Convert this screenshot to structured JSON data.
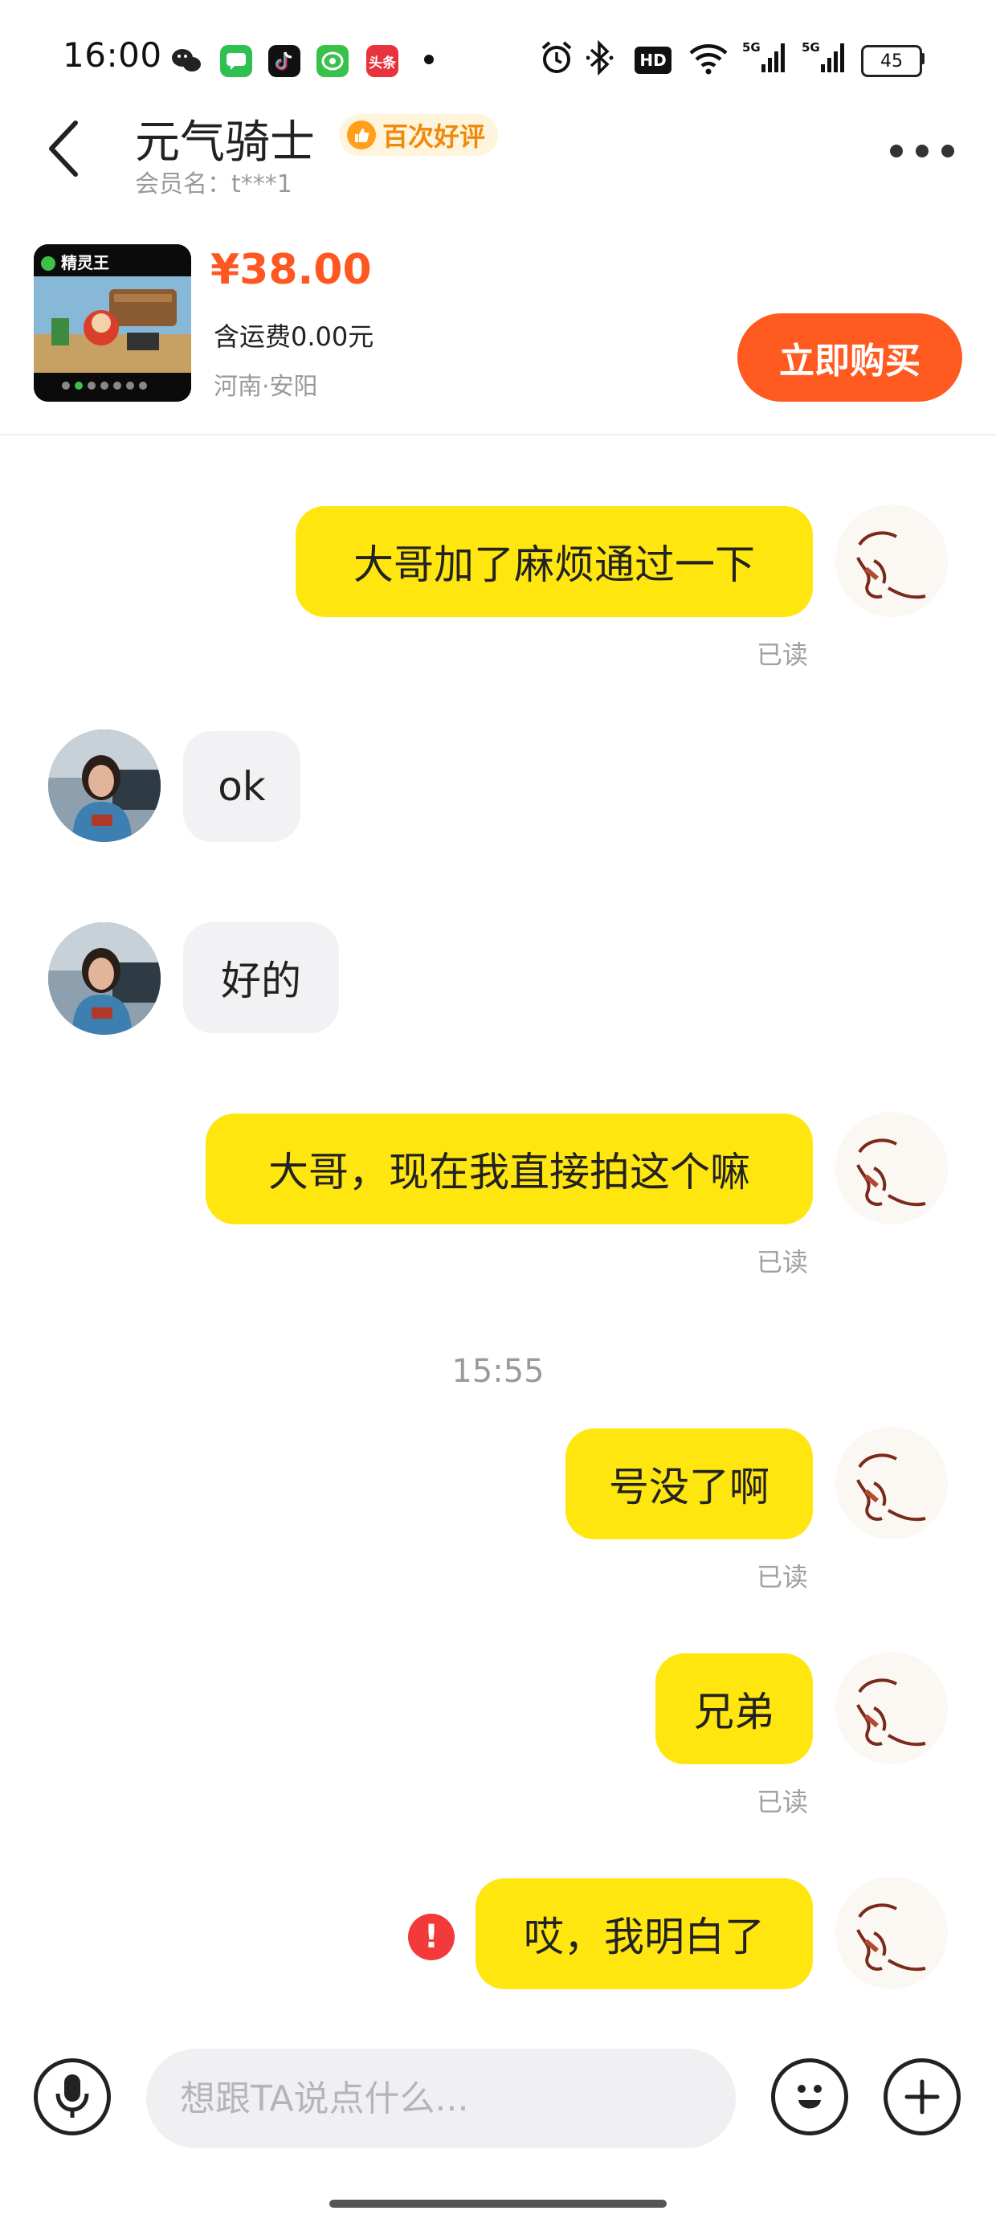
{
  "status_bar": {
    "time": "16:00",
    "apps": [
      {
        "icon": "wechat-icon",
        "color": "#222222"
      },
      {
        "icon": "messages-icon",
        "color": "#2ec050"
      },
      {
        "icon": "tiktok-icon",
        "color": "#111111"
      },
      {
        "icon": "facetime-icon",
        "color": "#39c24a"
      },
      {
        "icon": "toutiao-icon",
        "color": "#e8323c",
        "label": "头条"
      }
    ],
    "system_icons": [
      "alarm-icon",
      "bluetooth-icon",
      "hd-icon",
      "wifi-icon",
      "signal-5g-icon",
      "signal-5g-icon"
    ],
    "hd_label": "HD",
    "net_label": "5G",
    "battery": "45"
  },
  "header": {
    "title": "元气骑士",
    "badge": "百次好评",
    "member": "会员名：t***1"
  },
  "product": {
    "price": "¥38.00",
    "shipping": "含运费0.00元",
    "location": "河南·安阳",
    "buy_label": "立即购买",
    "thumb_label": "精灵王"
  },
  "messages": [
    {
      "from": "me",
      "text": "大哥加了麻烦通过一下",
      "status": "已读"
    },
    {
      "from": "other",
      "text": "ok"
    },
    {
      "from": "other",
      "text": "好的"
    },
    {
      "from": "me",
      "text": "大哥，现在我直接拍这个嘛",
      "status": "已读"
    },
    {
      "type": "time",
      "text": "15:55"
    },
    {
      "from": "me",
      "text": "号没了啊",
      "status": "已读"
    },
    {
      "from": "me",
      "text": "兄弟",
      "status": "已读"
    },
    {
      "from": "me",
      "text": "哎，我明白了",
      "status": "failed"
    }
  ],
  "input": {
    "placeholder": "想跟TA说点什么..."
  },
  "colors": {
    "accent": "#ff5a1f",
    "bubble_me": "#ffe60f",
    "bubble_other": "#f2f2f4",
    "price": "#ff5722",
    "error": "#f23a3a"
  }
}
